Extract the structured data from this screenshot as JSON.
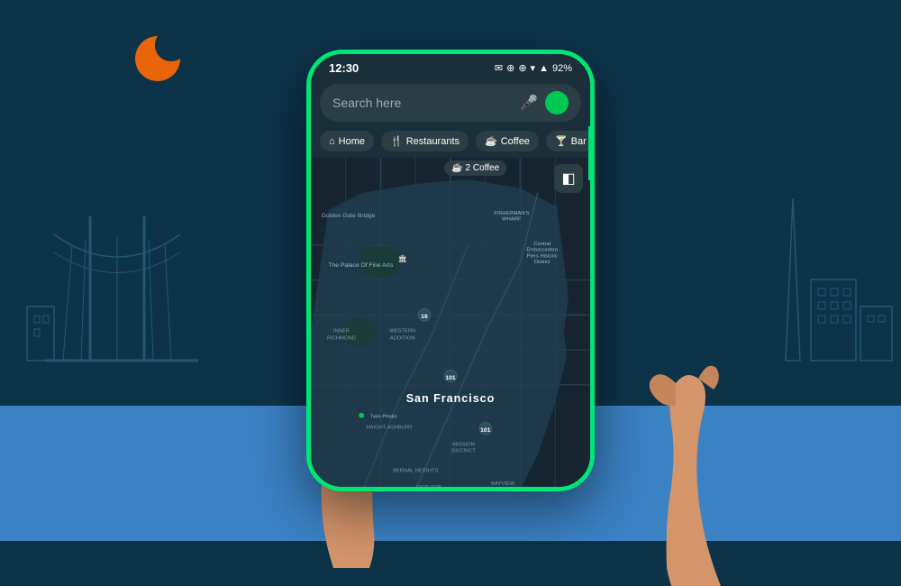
{
  "background": {
    "color_top": "#0d3349",
    "color_bottom": "#3b82c4"
  },
  "status_bar": {
    "time": "12:30",
    "battery": "92%",
    "icons": "✉ ⊕ ▾ ▲ ▮"
  },
  "search": {
    "placeholder": "Search here",
    "mic_icon": "🎤",
    "green_dot_color": "#00c853"
  },
  "categories": [
    {
      "label": "Home",
      "icon": "⌂"
    },
    {
      "label": "Restaurants",
      "icon": "🍴"
    },
    {
      "label": "Coffee",
      "icon": "☕"
    },
    {
      "label": "Bar",
      "icon": "🍸"
    }
  ],
  "map": {
    "city": "San Francisco",
    "label_golden_gate": "Golden Gate Bridge",
    "label_palace": "The Palace Of Fine Arts",
    "label_central": "Central\nEmbarcadero\nPiers Historic\nDistrict",
    "label_fishermans": "FISHERMAN'S\nWHARF",
    "label_inner_richmond": "INNER\nRICHMOND",
    "label_western_addition": "WESTERN\nADDITION",
    "label_haight": "HAIGHT-ASHBURY",
    "label_mission": "MISSION\nDISTRICT",
    "label_bernal": "BERNAL HEIGHTS",
    "layers_icon": "◧"
  },
  "coffee_badge": "2 Coffee"
}
